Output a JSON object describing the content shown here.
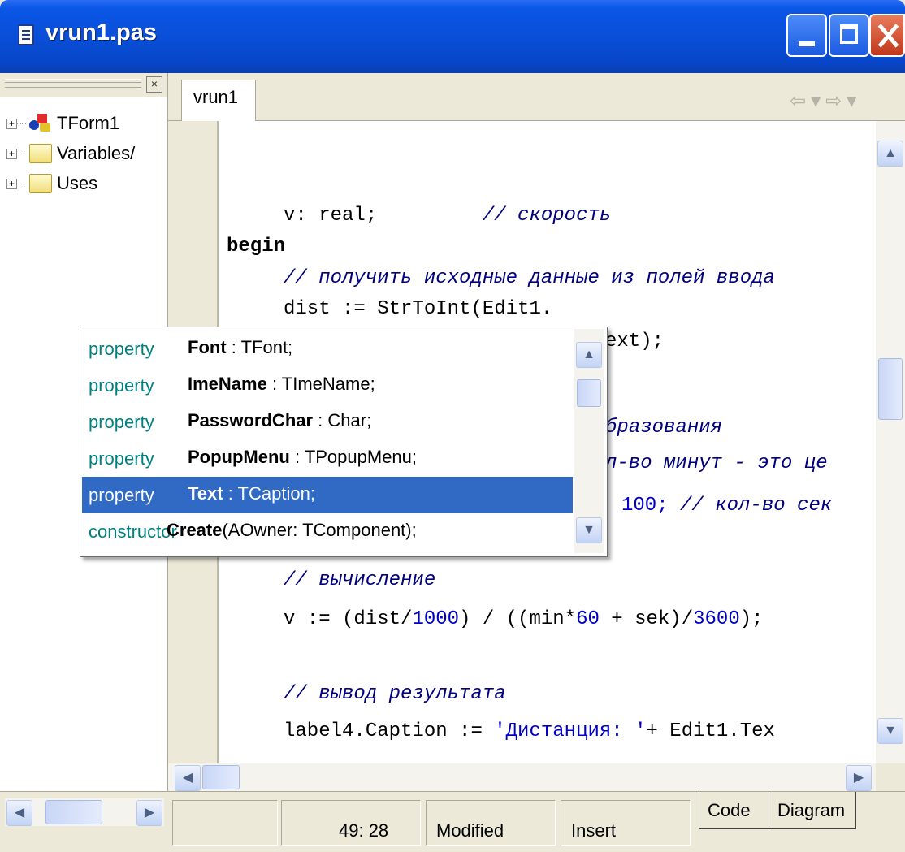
{
  "window": {
    "title": "vrun1.pas"
  },
  "explorer": {
    "nodes": [
      {
        "label": "TForm1",
        "icon": "form-icon"
      },
      {
        "label": "Variables/",
        "icon": "folder-icon"
      },
      {
        "label": "Uses",
        "icon": "folder-icon"
      }
    ]
  },
  "editor": {
    "tab": "vrun1",
    "lines": {
      "l1a": "v: real;",
      "l1b": "// скорость",
      "l2": "begin",
      "l3": "// получить исходные данные из полей ввода",
      "l4": "dist := StrToInt(Edit1.",
      "l5": "ext);",
      "l7": "бразования",
      "l8": "л-во минут - это це",
      "l9a": "100;",
      "l9b": "// кол-во сек",
      "l11": "// вычисление",
      "l12a": "v := (dist/",
      "l12b": "1000",
      "l12c": ") / ((min*",
      "l12d": "60",
      "l12e": " + sek)/",
      "l12f": "3600",
      "l12g": ");",
      "l14": "// вывод результата",
      "l15a": "label4.Caption := ",
      "l15b": "'Дистанция: '",
      "l15c": "+ Edit1.Tex"
    }
  },
  "completion": {
    "items": [
      {
        "kind": "property",
        "name": "Font",
        "type": " : TFont;"
      },
      {
        "kind": "property",
        "name": "ImeName",
        "type": " : TImeName;"
      },
      {
        "kind": "property",
        "name": "PasswordChar",
        "type": " : Char;"
      },
      {
        "kind": "property",
        "name": "PopupMenu",
        "type": " : TPopupMenu;"
      },
      {
        "kind": "property",
        "name": "Text",
        "type": " : TCaption;"
      },
      {
        "kind": "constructor",
        "name": "Create",
        "type": "(AOwner: TComponent);"
      }
    ],
    "selected_index": 4
  },
  "status": {
    "position": "49: 28",
    "modified": "Modified",
    "mode": "Insert",
    "tab_code": "Code",
    "tab_diagram": "Diagram"
  }
}
